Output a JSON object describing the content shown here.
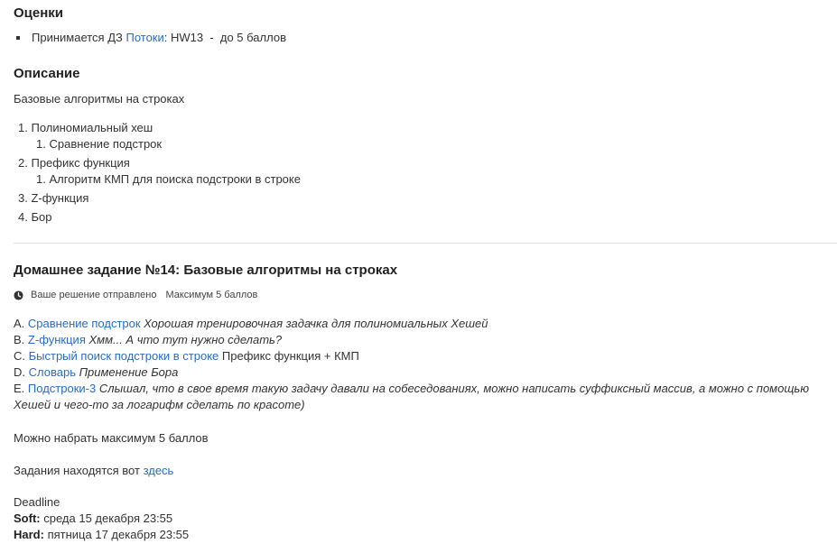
{
  "grades": {
    "title": "Оценки",
    "item": {
      "prefix": "Принимается ДЗ ",
      "link": "Потоки",
      "suffix": ": HW13  -  до 5 баллов"
    }
  },
  "description": {
    "title": "Описание",
    "text": "Базовые алгоритмы на строках",
    "topics": [
      {
        "num": "1.",
        "label": "Полиномиальный хеш",
        "sub": {
          "num": "1.",
          "label": "Сравнение подстрок"
        }
      },
      {
        "num": "2.",
        "label": "Префикс функция",
        "sub": {
          "num": "1.",
          "label": "Алгоритм КМП для поиска подстроки в строке"
        }
      },
      {
        "num": "3.",
        "label": "Z-функция"
      },
      {
        "num": "4.",
        "label": "Бор"
      }
    ]
  },
  "homework": {
    "title": "Домашнее задание №14: Базовые алгоритмы на строках",
    "status": "Ваше решение отправлено",
    "max": "Максимум 5 баллов",
    "tasks": [
      {
        "letter": "A.",
        "link": "Сравнение подстрок",
        "note": "Хорошая тренировочная задачка для полиномиальных Хешей",
        "plain": ""
      },
      {
        "letter": "B.",
        "link": "Z-функция",
        "note": "Хмм... А что тут нужно сделать?",
        "plain": ""
      },
      {
        "letter": "C.",
        "link": "Быстрый поиск подстроки в строке",
        "note": "",
        "plain": "Префикс функция + КМП"
      },
      {
        "letter": "D.",
        "link": "Словарь",
        "note": "Применение Бора",
        "plain": ""
      },
      {
        "letter": "E.",
        "link": "Подстроки-3",
        "note": "Слышал, что в свое время такую задачу давали на собеседованиях, можно написать суффиксный массив, а можно с помощью Хешей и чего-то за логарифм сделать по красоте)",
        "plain": ""
      }
    ],
    "max_text": "Можно набрать максимум 5 баллов",
    "where_prefix": "Задания находятся вот ",
    "where_link": "здесь",
    "deadline": {
      "label": "Deadline",
      "soft_label": "Soft:",
      "soft_value": "среда 15 декабря 23:55",
      "hard_label": "Hard:",
      "hard_value": "пятница 17 декабря 23:55"
    }
  },
  "colors": {
    "link": "#2b6cc4",
    "text": "#333333",
    "heading": "#222222",
    "divider": "#e2e2e2"
  },
  "icons": {
    "status": "clock-icon"
  }
}
